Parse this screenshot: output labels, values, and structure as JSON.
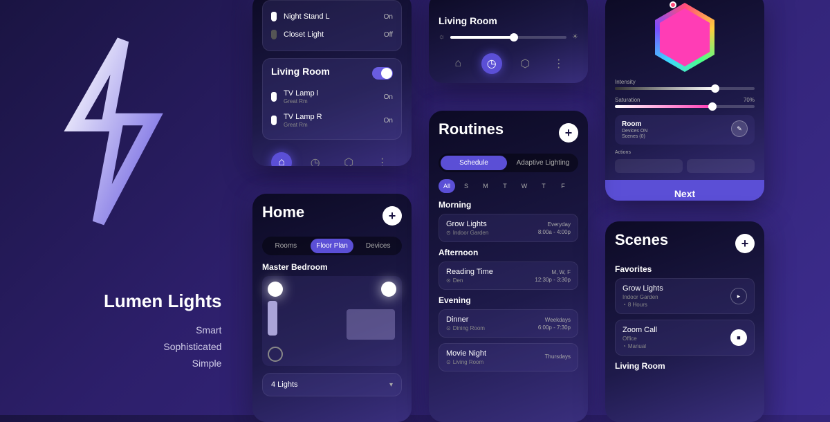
{
  "brand": {
    "title": "Lumen Lights",
    "taglines": [
      "Smart",
      "Sophisticated",
      "Simple"
    ]
  },
  "screen1": {
    "rows_top": [
      {
        "name": "Night Stand L",
        "sub": "",
        "state": "On"
      },
      {
        "name": "Closet Light",
        "sub": "",
        "state": "Off"
      }
    ],
    "room_title": "Living Room",
    "rows_room": [
      {
        "name": "TV Lamp l",
        "sub": "Great Rm",
        "state": "On"
      },
      {
        "name": "TV Lamp R",
        "sub": "Great Rm",
        "state": "On"
      }
    ]
  },
  "screen2": {
    "room_title": "Living Room"
  },
  "home": {
    "title": "Home",
    "tabs": [
      "Rooms",
      "Floor Plan",
      "Devices"
    ],
    "room": "Master Bedroom",
    "count": "4 Lights"
  },
  "routines": {
    "title": "Routines",
    "tabs": [
      "Schedule",
      "Adaptive Lighting"
    ],
    "days": [
      "All",
      "S",
      "M",
      "T",
      "W",
      "T",
      "F"
    ],
    "sections": {
      "morning": "Morning",
      "afternoon": "Afternoon",
      "evening": "Evening"
    },
    "items": {
      "grow": {
        "name": "Grow Lights",
        "loc": "Indoor Garden",
        "days": "Everyday",
        "time": "8:00a - 4:00p"
      },
      "reading": {
        "name": "Reading Time",
        "loc": "Den",
        "days": "M, W, F",
        "time": "12:30p - 3:30p"
      },
      "dinner": {
        "name": "Dinner",
        "loc": "Dining Room",
        "days": "Weekdays",
        "time": "6:00p - 7:30p"
      },
      "movie": {
        "name": "Movie Night",
        "loc": "Living Room",
        "days": "Thursdays",
        "time": ""
      }
    }
  },
  "color": {
    "sliders": {
      "intensity": {
        "label": "Intensity",
        "right": ""
      },
      "saturation": {
        "label": "Saturation",
        "right": "70%"
      }
    },
    "summary": {
      "title": "Room",
      "line1": "Devices ON",
      "line2": "Scenes (0)"
    },
    "chips_label": "Actions",
    "next": "Next"
  },
  "scenes": {
    "title": "Scenes",
    "favorites": "Favorites",
    "items": {
      "grow": {
        "name": "Grow Lights",
        "loc": "Indoor Garden",
        "dur": "8 Hours"
      },
      "zoom": {
        "name": "Zoom Call",
        "loc": "Office",
        "dur": "Manual"
      }
    },
    "living": "Living Room"
  }
}
